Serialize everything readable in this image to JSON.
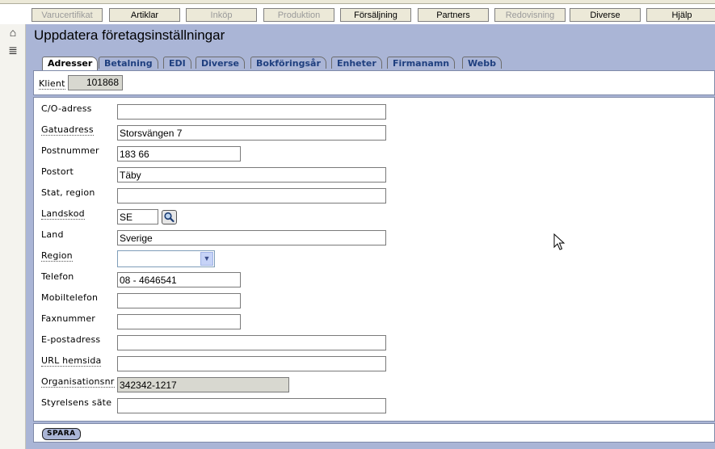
{
  "menu": {
    "items": [
      {
        "label": "Varucertifikat",
        "enabled": false
      },
      {
        "label": "Artiklar",
        "enabled": true
      },
      {
        "label": "Inköp",
        "enabled": false
      },
      {
        "label": "Produktion",
        "enabled": false
      },
      {
        "label": "Försäljning",
        "enabled": true
      },
      {
        "label": "Partners",
        "enabled": true
      },
      {
        "label": "Redovisning",
        "enabled": false
      },
      {
        "label": "Diverse",
        "enabled": true
      },
      {
        "label": "Hjälp",
        "enabled": true
      }
    ]
  },
  "sidebar": {
    "icons": [
      "home-icon",
      "list-icon"
    ]
  },
  "page": {
    "title": "Uppdatera företagsinställningar"
  },
  "tabs": [
    {
      "label": "Adresser",
      "active": true
    },
    {
      "label": "Betalning",
      "active": false
    },
    {
      "label": "EDI",
      "active": false
    },
    {
      "label": "Diverse",
      "active": false
    },
    {
      "label": "Bokföringsår",
      "active": false
    },
    {
      "label": "Enheter",
      "active": false
    },
    {
      "label": "Firmanamn",
      "active": false
    },
    {
      "label": "Webb",
      "active": false
    }
  ],
  "klient": {
    "label": "Klient",
    "value": "101868"
  },
  "form": {
    "co_address": {
      "label": "C/O-adress",
      "value": ""
    },
    "street": {
      "label": "Gatuadress",
      "value": "Storsvängen 7"
    },
    "postal": {
      "label": "Postnummer",
      "value": "183 66"
    },
    "city": {
      "label": "Postort",
      "value": "Täby"
    },
    "state": {
      "label": "Stat, region",
      "value": ""
    },
    "country_code": {
      "label": "Landskod",
      "value": "SE"
    },
    "country": {
      "label": "Land",
      "value": "Sverige"
    },
    "region": {
      "label": "Region",
      "value": ""
    },
    "phone": {
      "label": "Telefon",
      "value": "08 - 4646541"
    },
    "mobile": {
      "label": "Mobiltelefon",
      "value": ""
    },
    "fax": {
      "label": "Faxnummer",
      "value": ""
    },
    "email": {
      "label": "E-postadress",
      "value": ""
    },
    "url": {
      "label": "URL hemsida",
      "value": ""
    },
    "org_number": {
      "label": "Organisationsnr",
      "value": "342342-1217"
    },
    "board_seat": {
      "label": "Styrelsens säte",
      "value": ""
    }
  },
  "actions": {
    "save_label": "SPARA"
  },
  "colors": {
    "background": "#aab5d6",
    "tab_text": "#1f3f7f"
  }
}
